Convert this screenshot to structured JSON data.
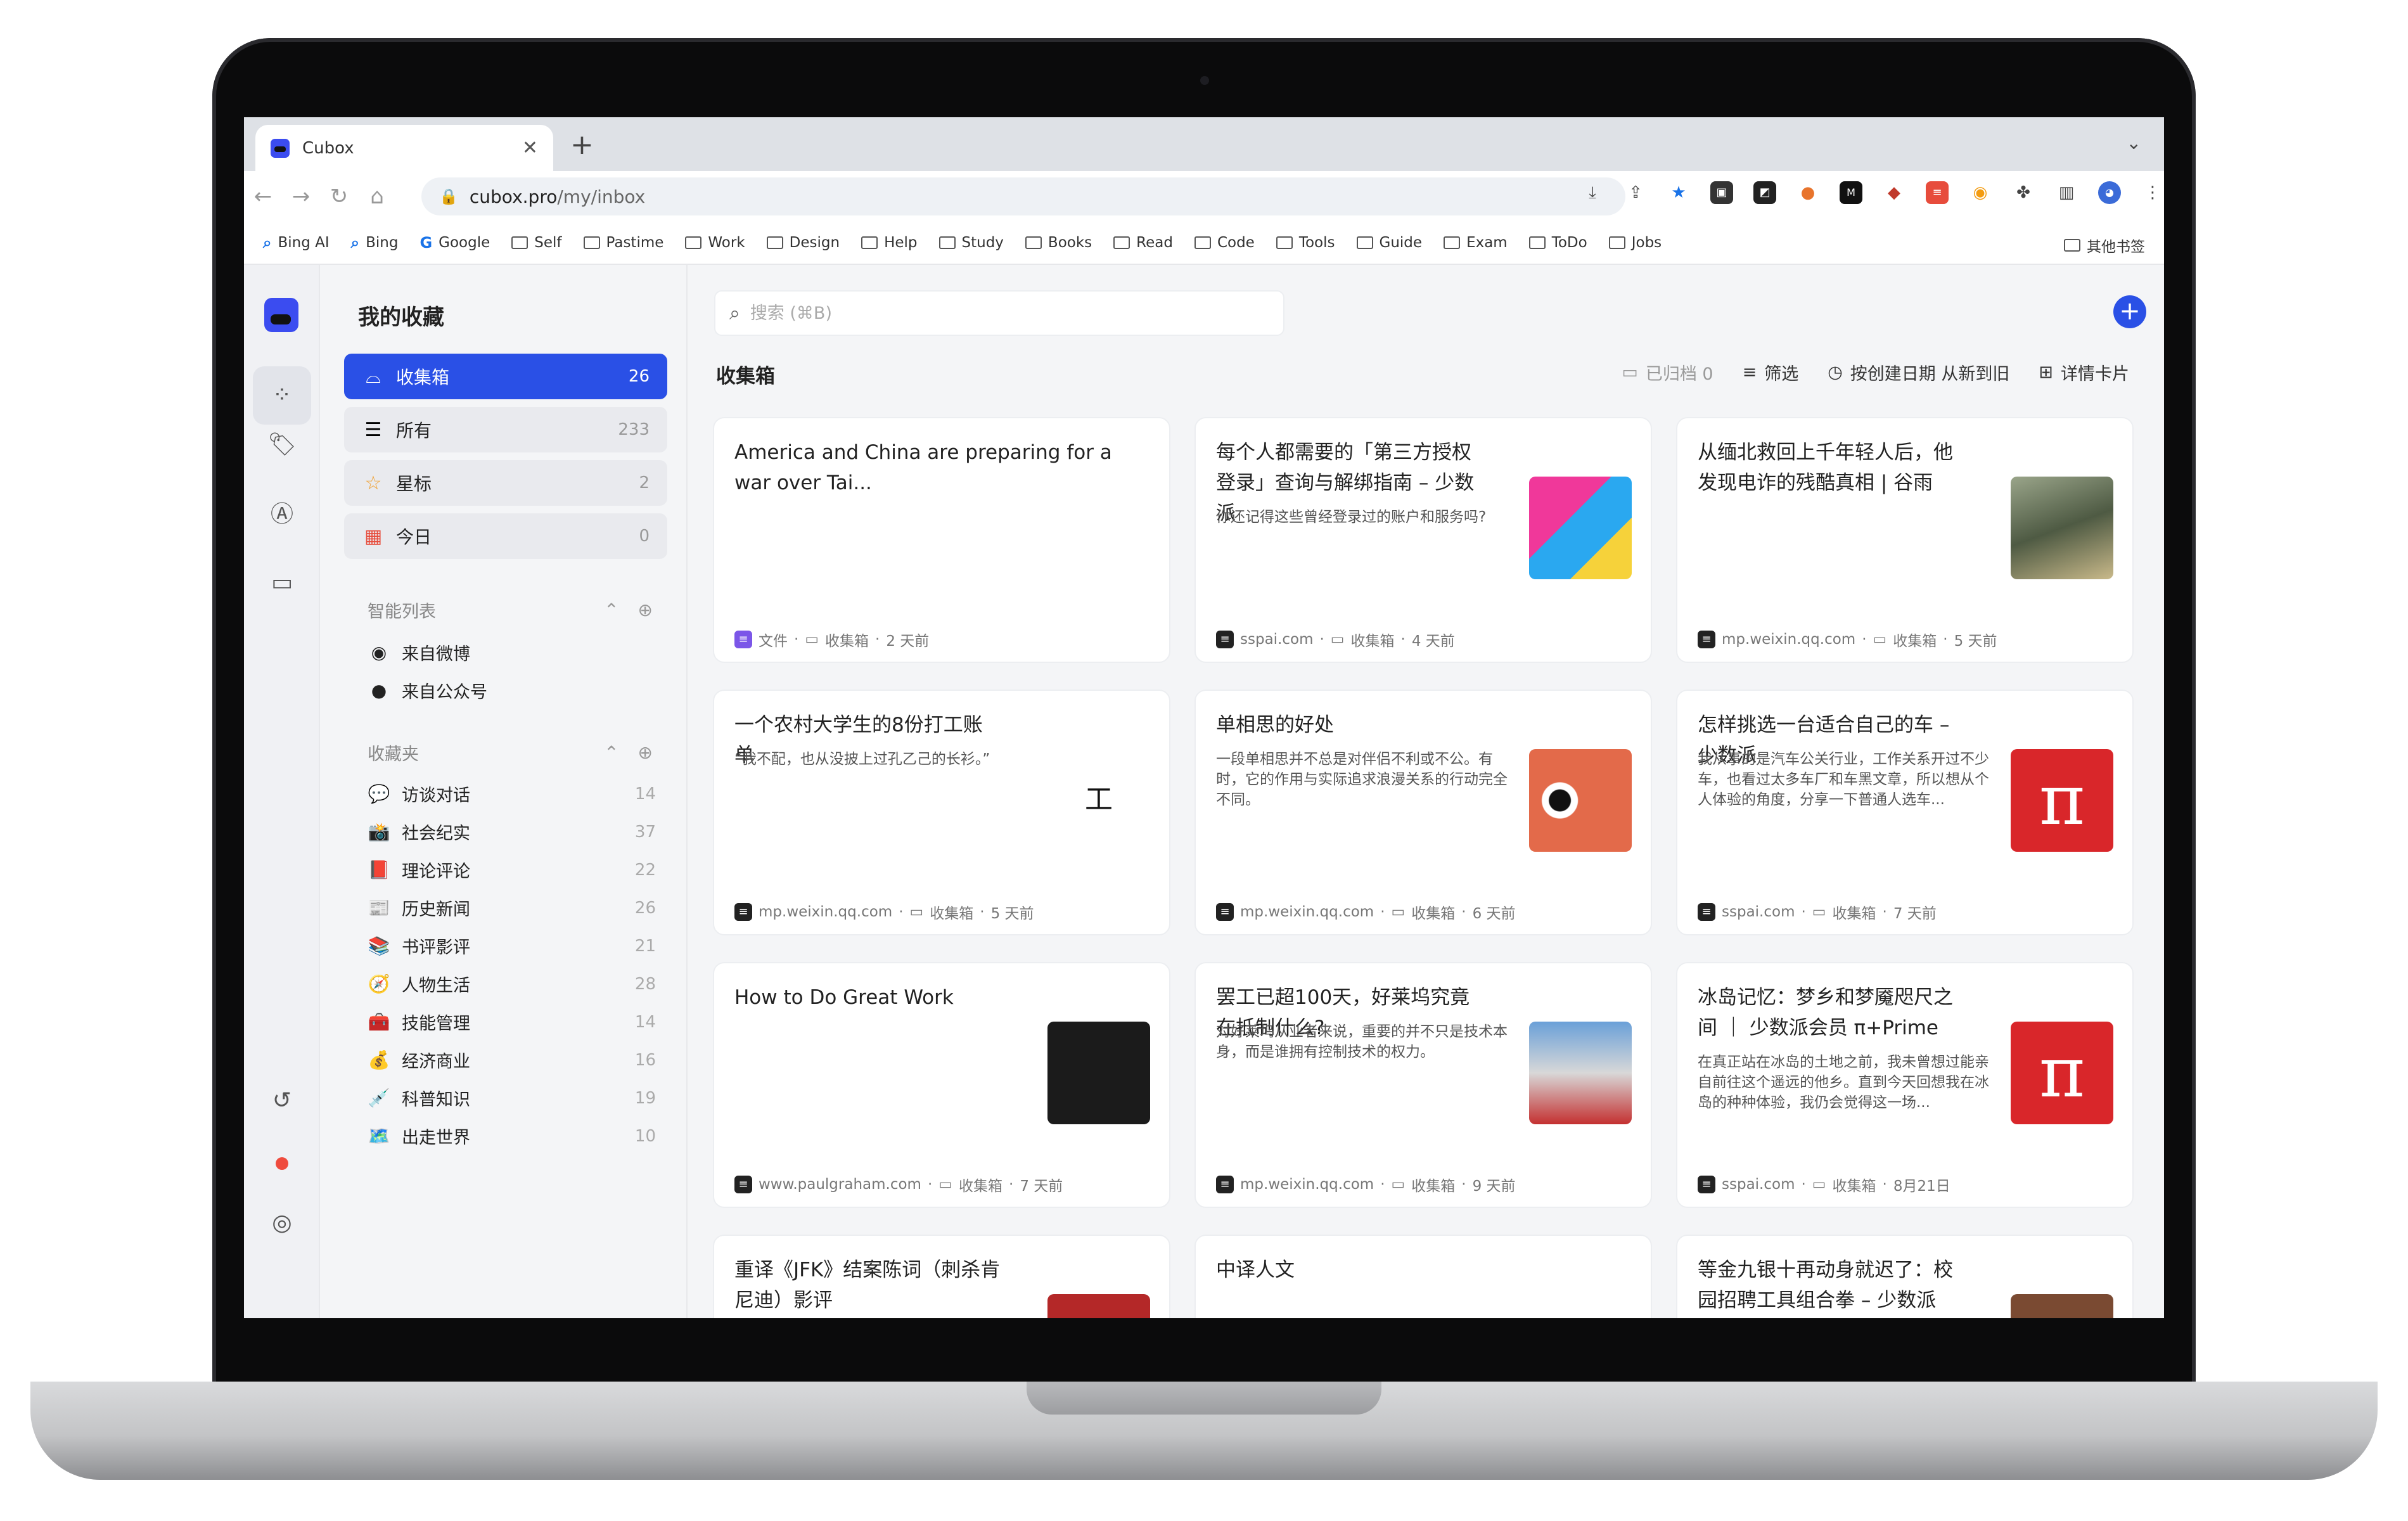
{
  "browser": {
    "tab_title": "Cubox",
    "url_host": "cubox.pro",
    "url_path": "/my/inbox",
    "bookmarks": [
      "Bing AI",
      "Bing",
      "Google",
      "Self",
      "Pastime",
      "Work",
      "Design",
      "Help",
      "Study",
      "Books",
      "Read",
      "Code",
      "Tools",
      "Guide",
      "Exam",
      "ToDo",
      "Jobs"
    ],
    "other_bookmarks": "其他书签"
  },
  "sidebar": {
    "heading": "我的收藏",
    "nav": [
      {
        "label": "收集箱",
        "count": "26"
      },
      {
        "label": "所有",
        "count": "233"
      },
      {
        "label": "星标",
        "count": "2"
      },
      {
        "label": "今日",
        "count": "0"
      }
    ],
    "smart_title": "智能列表",
    "smart": [
      "来自微博",
      "来自公众号"
    ],
    "folders_title": "收藏夹",
    "folders": [
      {
        "e": "💬",
        "n": "访谈对话",
        "c": "14"
      },
      {
        "e": "📸",
        "n": "社会纪实",
        "c": "37"
      },
      {
        "e": "📕",
        "n": "理论评论",
        "c": "22"
      },
      {
        "e": "📰",
        "n": "历史新闻",
        "c": "26"
      },
      {
        "e": "📚",
        "n": "书评影评",
        "c": "21"
      },
      {
        "e": "🧭",
        "n": "人物生活",
        "c": "28"
      },
      {
        "e": "🧰",
        "n": "技能管理",
        "c": "14"
      },
      {
        "e": "💰",
        "n": "经济商业",
        "c": "16"
      },
      {
        "e": "💉",
        "n": "科普知识",
        "c": "19"
      },
      {
        "e": "🗺️",
        "n": "出走世界",
        "c": "10"
      }
    ]
  },
  "main": {
    "search_placeholder": "搜索 (⌘B)",
    "title": "收集箱",
    "archived": "已归档 0",
    "filter": "筛选",
    "sort": "按创建日期 从新到旧",
    "view": "详情卡片",
    "cards": [
      {
        "title": "America and China are preparing for a war over Tai...",
        "desc": "",
        "src": "文件",
        "folder": "收集箱",
        "time": "2 天前",
        "thumb": "none",
        "badge": "purple"
      },
      {
        "title": "每个人都需要的「第三方授权登录」查询与解绑指南 – 少数派",
        "desc": "你还记得这些曾经登录过的账户和服务吗?",
        "src": "sspai.com",
        "folder": "收集箱",
        "time": "4 天前",
        "thumb": "cartoon"
      },
      {
        "title": "从缅北救回上千年轻人后，他发现电诈的残酷真相 | 谷雨",
        "desc": "",
        "src": "mp.weixin.qq.com",
        "folder": "收集箱",
        "time": "5 天前",
        "thumb": "photo"
      },
      {
        "title": "一个农村大学生的8份打工账单",
        "desc": "“我不配，也从没披上过孔乙己的长衫。”",
        "src": "mp.weixin.qq.com",
        "folder": "收集箱",
        "time": "5 天前",
        "thumb": "work"
      },
      {
        "title": "单相思的好处",
        "desc": "一段单相思并不总是对伴侣不利或不公。有时，它的作用与实际追求浪漫关系的行动完全不同。",
        "src": "mp.weixin.qq.com",
        "folder": "收集箱",
        "time": "6 天前",
        "thumb": "eyes"
      },
      {
        "title": "怎样挑选一台适合自己的车 – 少数派",
        "desc": "我从事的是汽车公关行业，工作关系开过不少车，也看过太多车厂和车黑文章，所以想从个人体验的角度，分享一下普通人选车...",
        "src": "sspai.com",
        "folder": "收集箱",
        "time": "7 天前",
        "thumb": "pi"
      },
      {
        "title": "How to Do Great Work",
        "desc": "",
        "src": "www.paulgraham.com",
        "folder": "收集箱",
        "time": "7 天前",
        "thumb": "dark"
      },
      {
        "title": "罢工已超100天，好莱坞究竟在抵制什么?",
        "desc": "对好莱坞从业者来说，重要的并不只是技术本身，而是谁拥有控制技术的权力。",
        "src": "mp.weixin.qq.com",
        "folder": "收集箱",
        "time": "9 天前",
        "thumb": "city"
      },
      {
        "title": "冰岛记忆：梦乡和梦魇咫尺之间 ｜ 少数派会员 π+Prime",
        "desc": "在真正站在冰岛的土地之前，我未曾想过能亲自前往这个遥远的他乡。直到今天回想我在冰岛的种种体验，我仍会觉得这一场...",
        "src": "sspai.com",
        "folder": "收集箱",
        "time": "8月21日",
        "thumb": "pi"
      },
      {
        "title": "重译《JFK》结案陈词（刺杀肯尼迪）影评",
        "desc": "",
        "src": "",
        "folder": "",
        "time": "",
        "thumb": "red"
      },
      {
        "title": "中译人文",
        "desc": "",
        "src": "",
        "folder": "",
        "time": "",
        "thumb": "none"
      },
      {
        "title": "等金九银十再动身就迟了：校园招聘工具组合拳 – 少数派",
        "desc": "",
        "src": "",
        "folder": "",
        "time": "",
        "thumb": "brown"
      }
    ]
  }
}
